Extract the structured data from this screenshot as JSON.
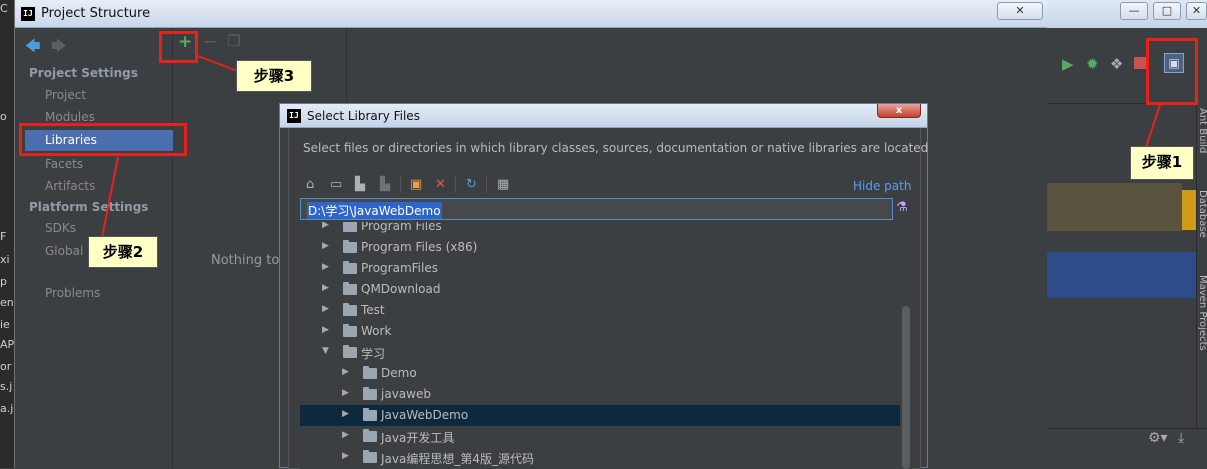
{
  "project_structure": {
    "title": "Project Structure",
    "close_glyph": "✕",
    "nav": {
      "back_glyph": "🡄",
      "forward_glyph": "🡆",
      "section_project_settings": "Project Settings",
      "items_project": [
        "Project",
        "Modules",
        "Libraries",
        "Facets",
        "Artifacts"
      ],
      "section_platform_settings": "Platform Settings",
      "items_platform": [
        "SDKs",
        "Global"
      ],
      "problems": "Problems"
    },
    "toolbar": {
      "add_glyph": "+",
      "remove_glyph": "−",
      "copy_glyph": "❐"
    },
    "empty_text": "Nothing to"
  },
  "select_library_files": {
    "title": "Select Library Files",
    "close_glyph": "x",
    "description": "Select files or directories in which library classes, sources, documentation or native libraries are located",
    "toolbar_icons": [
      "home-icon",
      "desktop-icon",
      "project-icon",
      "module-icon",
      "new-folder-icon",
      "delete-icon",
      "refresh-icon",
      "show-hidden-icon"
    ],
    "hide_path": "Hide path",
    "path_value": "D:\\学习\\JavaWebDemo",
    "tree": [
      {
        "label": "Program Files",
        "depth": 0,
        "expanded": false,
        "selected": false
      },
      {
        "label": "Program Files (x86)",
        "depth": 0,
        "expanded": false,
        "selected": false
      },
      {
        "label": "ProgramFiles",
        "depth": 0,
        "expanded": false,
        "selected": false
      },
      {
        "label": "QMDownload",
        "depth": 0,
        "expanded": false,
        "selected": false
      },
      {
        "label": "Test",
        "depth": 0,
        "expanded": false,
        "selected": false
      },
      {
        "label": "Work",
        "depth": 0,
        "expanded": false,
        "selected": false
      },
      {
        "label": "学习",
        "depth": 0,
        "expanded": true,
        "selected": false
      },
      {
        "label": "Demo",
        "depth": 1,
        "expanded": false,
        "selected": false
      },
      {
        "label": "javaweb",
        "depth": 1,
        "expanded": false,
        "selected": false
      },
      {
        "label": "JavaWebDemo",
        "depth": 1,
        "expanded": false,
        "selected": true
      },
      {
        "label": "Java开发工具",
        "depth": 1,
        "expanded": false,
        "selected": false
      },
      {
        "label": "Java编程思想_第4版_源代码",
        "depth": 1,
        "expanded": false,
        "selected": false
      }
    ]
  },
  "ide_background": {
    "side_tabs": [
      "Ant Build",
      "Database",
      "Maven Projects"
    ],
    "left_fragments": [
      "C",
      "o",
      "F",
      "xi",
      "p",
      "en",
      "ie",
      "AP",
      "or",
      "s.j",
      "a.j"
    ],
    "window_buttons": [
      "—",
      "□",
      "✕"
    ]
  },
  "annotations": {
    "step1": "步骤1",
    "step2": "步骤2",
    "step3": "步骤3"
  },
  "colors": {
    "dialog_bg": "#3c3f41",
    "selection_bg": "#4b6eaf",
    "tree_selection_bg": "#0d293e",
    "link": "#589df6",
    "annotation_red": "#e8211b",
    "callout_bg": "#ffffc6"
  }
}
